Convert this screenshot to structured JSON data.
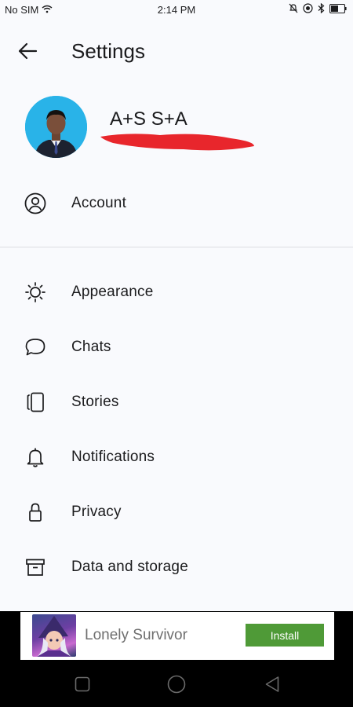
{
  "status_bar": {
    "carrier": "No SIM",
    "time": "2:14 PM",
    "icons": [
      "wifi-icon",
      "alarm-off-icon",
      "data-saver-icon",
      "bluetooth-icon",
      "battery-icon"
    ]
  },
  "header": {
    "title": "Settings",
    "back_icon": "arrow-left-icon"
  },
  "profile": {
    "name": "A+S S+A",
    "avatar_bg": "#29b3e8"
  },
  "menu": {
    "items": [
      {
        "label": "Account",
        "icon": "account-circle-icon"
      },
      {
        "label": "Appearance",
        "icon": "sun-icon"
      },
      {
        "label": "Chats",
        "icon": "chat-bubble-icon"
      },
      {
        "label": "Stories",
        "icon": "stories-icon"
      },
      {
        "label": "Notifications",
        "icon": "bell-icon"
      },
      {
        "label": "Privacy",
        "icon": "lock-icon"
      },
      {
        "label": "Data and storage",
        "icon": "archive-box-icon"
      }
    ]
  },
  "ad": {
    "title": "Lonely Survivor",
    "install_label": "Install",
    "install_color": "#4f9a37"
  },
  "nav_bar": {
    "buttons": [
      "recents-square-icon",
      "home-circle-icon",
      "back-triangle-icon"
    ]
  },
  "colors": {
    "background": "#f9fafd",
    "text": "#1b1b1d",
    "redaction": "#e8262c"
  }
}
